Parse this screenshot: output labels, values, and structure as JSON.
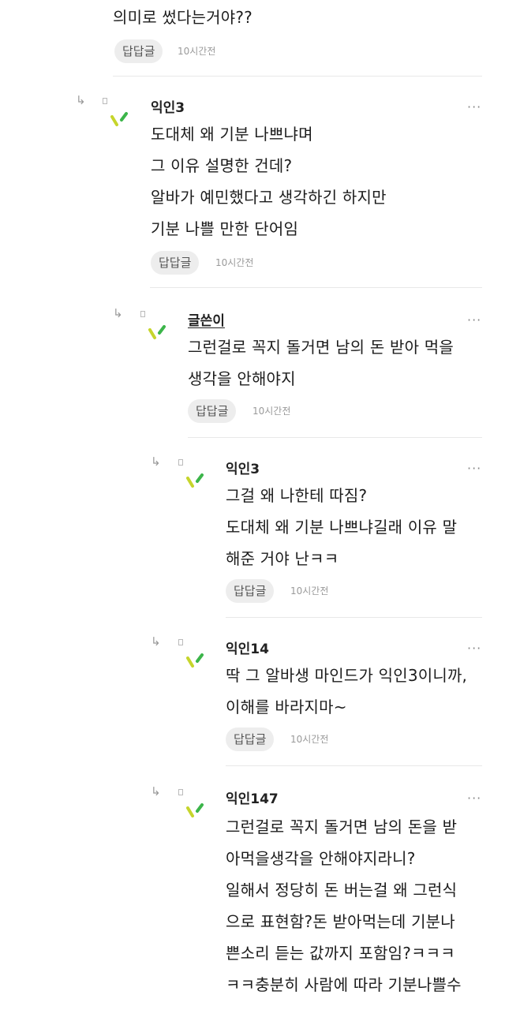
{
  "top": {
    "partial_text": "의미로 썼다는거야??",
    "reply_label": "답답글",
    "time": "10시간전"
  },
  "comments": [
    {
      "author": "익인3",
      "lines": [
        "도대체 왜 기분 나쁘냐며",
        "그 이유 설명한 건데?",
        "알바가 예민했다고 생각하긴 하지만",
        "기분 나쁠 만한 단어임"
      ],
      "reply_label": "답답글",
      "time": "10시간전",
      "more": "···"
    },
    {
      "author": "글쓴이",
      "lines": [
        "그런걸로 꼭지 돌거면 남의 돈 받아 먹을",
        "생각을 안해야지"
      ],
      "reply_label": "답답글",
      "time": "10시간전",
      "more": "···"
    },
    {
      "author": "익인3",
      "lines": [
        "그걸 왜 나한테 따짐?",
        "도대체 왜 기분 나쁘냐길래 이유 말",
        "해준 거야 난ㅋㅋ"
      ],
      "reply_label": "답답글",
      "time": "10시간전",
      "more": "···"
    },
    {
      "author": "익인14",
      "lines": [
        "딱 그 알바생 마인드가 익인3이니까,",
        "이해를 바라지마~"
      ],
      "reply_label": "답답글",
      "time": "10시간전",
      "more": "···"
    },
    {
      "author": "익인147",
      "lines": [
        "그런걸로 꼭지 돌거면 남의 돈을 받",
        "아먹을생각을 안해야지라니?",
        "일해서 정당히 돈 버는걸 왜 그런식",
        "으로 표현함?돈 받아먹는데 기분나",
        "쁜소리 듣는 값까지 포함임?ㅋㅋㅋ",
        "ㅋㅋ충분히 사람에 따라 기분나쁠수"
      ],
      "more": "···"
    }
  ],
  "icons": {
    "reply_arrow": "↳",
    "avatar": "avatar-icon"
  }
}
